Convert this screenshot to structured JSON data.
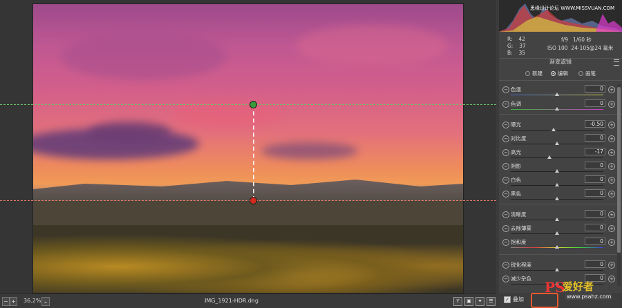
{
  "canvas": {
    "zoom": "36.2%",
    "filename": "IMG_1921-HDR.dng",
    "view_buttons": [
      "Y",
      "▣",
      "✦",
      "☰"
    ]
  },
  "readout": {
    "r_label": "R:",
    "r_value": "42",
    "g_label": "G:",
    "g_value": "37",
    "b_label": "B:",
    "b_value": "35",
    "aperture": "f/9",
    "shutter": "1/60 秒",
    "iso": "ISO 100",
    "lens": "24-105@24 毫米"
  },
  "histogram": {
    "watermark": "思缘设计论坛 WWW.MISSVUAN.COM"
  },
  "panel": {
    "title": "渐变滤镜",
    "modes": [
      {
        "label": "新建",
        "selected": false
      },
      {
        "label": "编辑",
        "selected": true
      },
      {
        "label": "画笔",
        "selected": false
      }
    ],
    "sliders": [
      {
        "label": "色温",
        "value": "0",
        "position": 0.5
      },
      {
        "label": "色调",
        "value": "0",
        "position": 0.5
      },
      {
        "label": "曝光",
        "value": "-0.50",
        "position": 0.46
      },
      {
        "label": "对比度",
        "value": "0",
        "position": 0.5
      },
      {
        "label": "高光",
        "value": "-17",
        "position": 0.415
      },
      {
        "label": "阴影",
        "value": "0",
        "position": 0.5
      },
      {
        "label": "白色",
        "value": "0",
        "position": 0.5
      },
      {
        "label": "黑色",
        "value": "0",
        "position": 0.5
      },
      {
        "label": "清晰度",
        "value": "0",
        "position": 0.5
      },
      {
        "label": "去除薄雾",
        "value": "0",
        "position": 0.5
      },
      {
        "label": "饱和度",
        "value": "0",
        "position": 0.5
      },
      {
        "label": "锐化程度",
        "value": "0",
        "position": 0.5
      },
      {
        "label": "减少杂色",
        "value": "0",
        "position": 0.5
      }
    ]
  },
  "footer": {
    "overlay_label": "叠加",
    "overlay_checked": true
  },
  "watermark": {
    "ps": "PS",
    "cn": "爱好者",
    "url": "www.psahz.com"
  },
  "colors": {
    "green_pin": "#3a9a3a",
    "red_pin": "#d22a1e",
    "highlight": "#e85a2e"
  }
}
